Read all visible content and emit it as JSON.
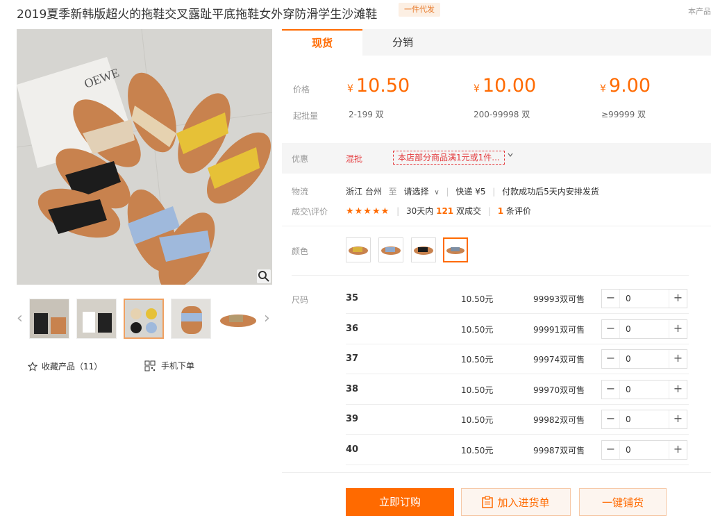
{
  "header": {
    "title": "2019夏季新韩版超火的拖鞋交叉露趾平底拖鞋女外穿防滑学生沙滩鞋",
    "badge": "一件代发",
    "corner": "本产品"
  },
  "tabs": [
    {
      "label": "现货"
    },
    {
      "label": "分销"
    }
  ],
  "price": {
    "price_label": "价格",
    "moq_label": "起批量",
    "currency": "¥",
    "tiers": [
      {
        "price": "10.50",
        "qty": "2-199 双"
      },
      {
        "price": "10.00",
        "qty": "200-99998 双"
      },
      {
        "price": "9.00",
        "qty": "≥99999 双"
      }
    ]
  },
  "promo": {
    "label": "优惠",
    "tag": "混批",
    "text": "本店部分商品满1元或1件..."
  },
  "logistics": {
    "label": "物流",
    "origin": "浙江 台州",
    "to": "至",
    "dest": "请选择",
    "ship": "快递 ¥5",
    "note": "付款成功后5天内安排发货"
  },
  "reviews": {
    "label": "成交\\评价",
    "stars": "★★★★★",
    "deals_prefix": "30天内",
    "deals_count": "121",
    "deals_suffix": "双成交",
    "review_count": "1",
    "review_suffix": "条评价"
  },
  "color": {
    "label": "颜色",
    "swatches": [
      "yellow",
      "blue",
      "black",
      "blue-selected"
    ]
  },
  "sizes": {
    "label": "尺码",
    "rows": [
      {
        "size": "35",
        "price": "10.50元",
        "stock": "99993双可售",
        "qty": "0"
      },
      {
        "size": "36",
        "price": "10.50元",
        "stock": "99991双可售",
        "qty": "0"
      },
      {
        "size": "37",
        "price": "10.50元",
        "stock": "99974双可售",
        "qty": "0"
      },
      {
        "size": "38",
        "price": "10.50元",
        "stock": "99970双可售",
        "qty": "0"
      },
      {
        "size": "39",
        "price": "10.50元",
        "stock": "99982双可售",
        "qty": "0"
      },
      {
        "size": "40",
        "price": "10.50元",
        "stock": "99987双可售",
        "qty": "0"
      }
    ]
  },
  "actions": {
    "buy": "立即订购",
    "cart": "加入进货单",
    "dist": "一键铺货"
  },
  "gallery": {
    "fav": "收藏产品（11）",
    "mobile": "手机下单"
  },
  "colors": {
    "accent": "#ff6a00"
  }
}
